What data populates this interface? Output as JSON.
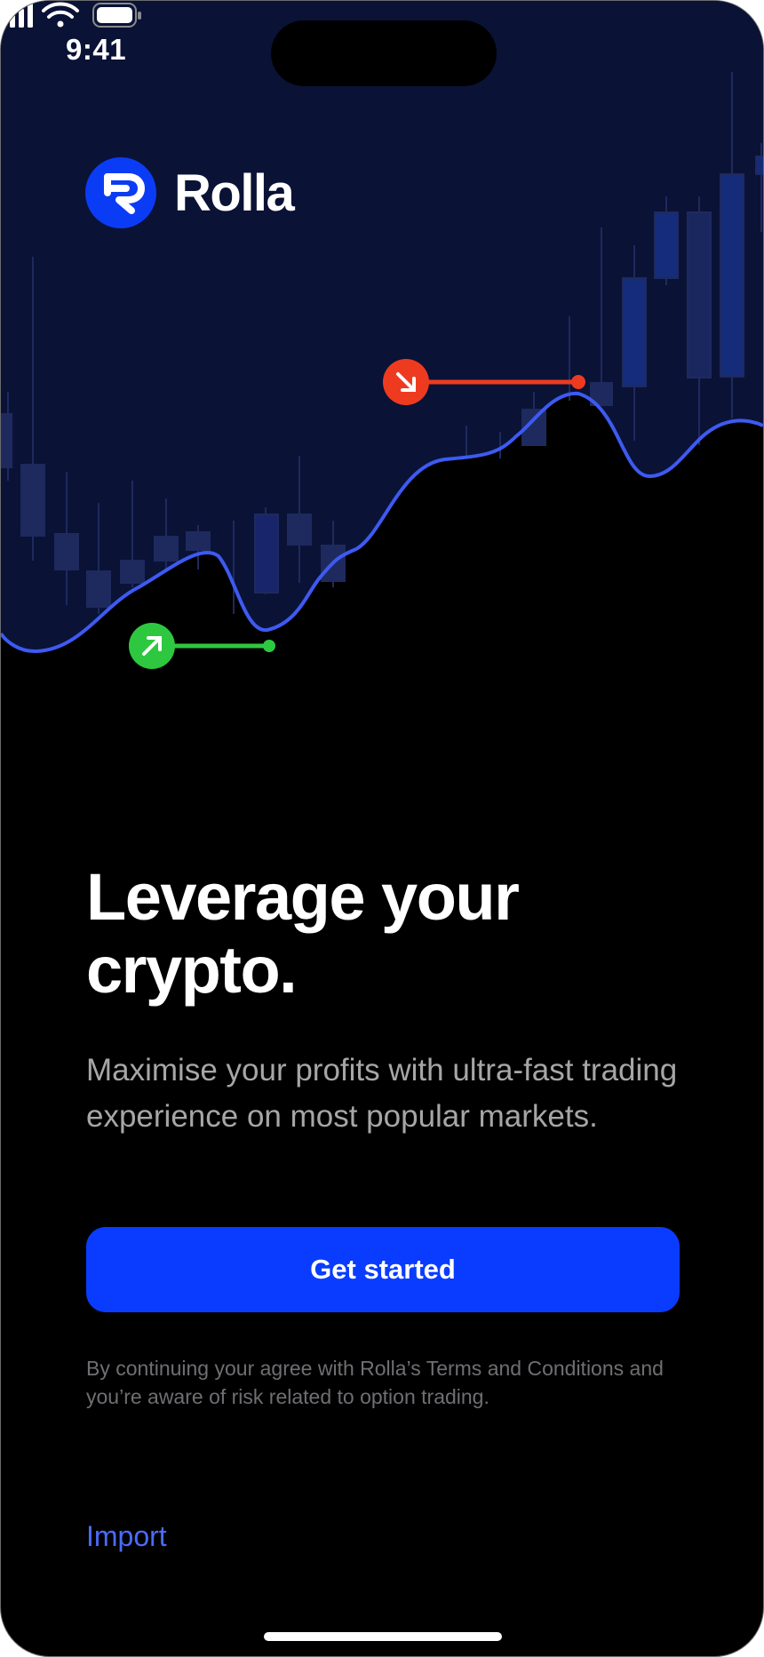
{
  "status_bar": {
    "time": "9:41",
    "icons": [
      "signal-icon",
      "wifi-icon",
      "battery-icon"
    ]
  },
  "brand": {
    "name": "Rolla",
    "logo_icon": "rolla-logo-icon",
    "accent": "#0a3cff"
  },
  "hero": {
    "background": "#0a1236",
    "line_color": "#3d5af1",
    "up_marker_color": "#2ec840",
    "down_marker_color": "#ee3b1f",
    "icons": [
      "arrow-up-right-icon",
      "arrow-down-right-icon"
    ]
  },
  "content": {
    "headline": "Leverage your crypto.",
    "subtitle": "Maximise your profits with ultra-fast trading experience on most popular markets.",
    "cta_label": "Get started",
    "legal": "By continuing your agree with Rolla’s Terms and Conditions and you’re aware of risk related to option trading.",
    "import_label": "Import"
  }
}
